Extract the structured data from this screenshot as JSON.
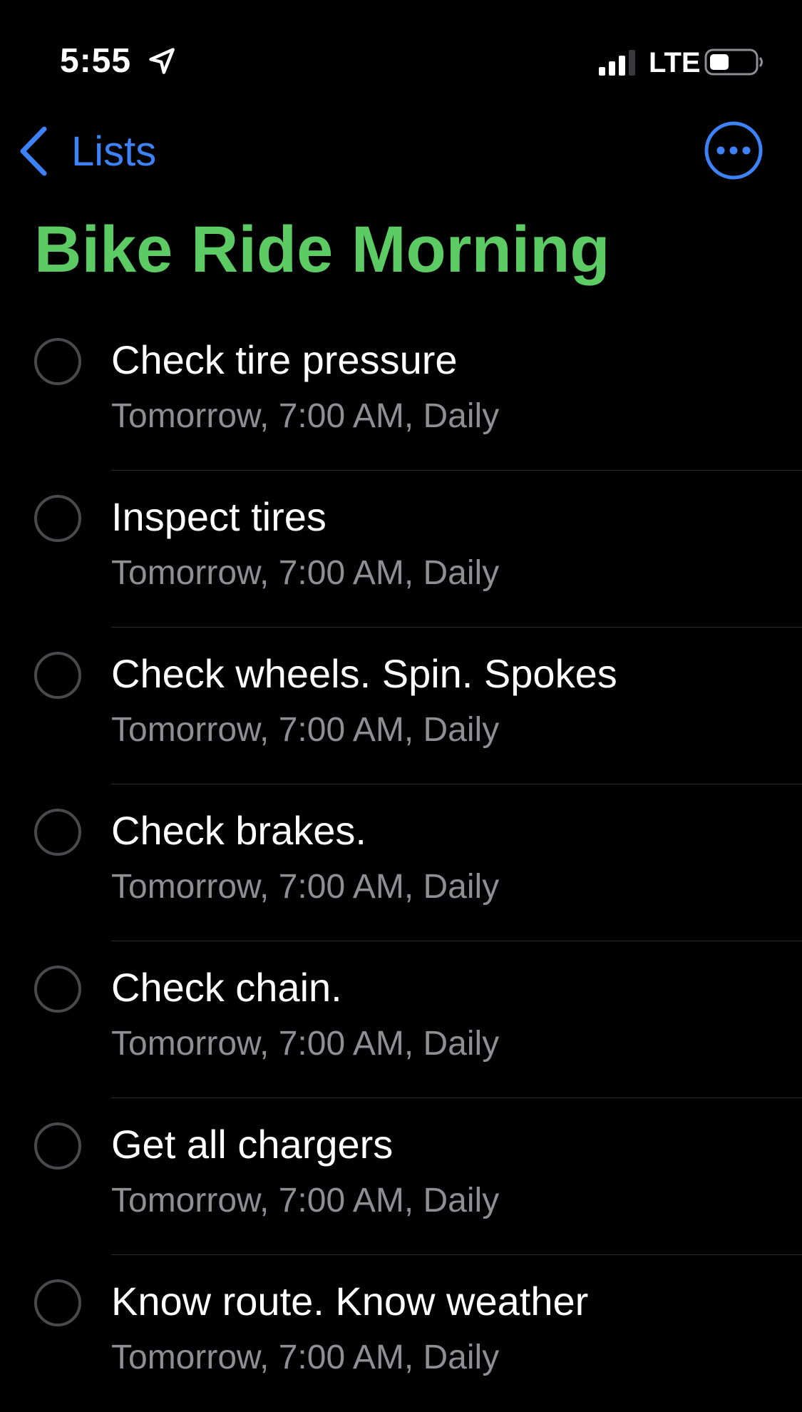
{
  "status_bar": {
    "time": "5:55",
    "location_icon": "location-arrow-icon",
    "signal_icon": "cellular-signal-icon",
    "network": "LTE",
    "battery_icon": "battery-icon"
  },
  "nav": {
    "back_label": "Lists",
    "back_icon": "chevron-left-icon",
    "more_icon": "ellipsis-circle-icon",
    "accent_color": "#3e82f7"
  },
  "list": {
    "title": "Bike Ride Morning",
    "title_color": "#5dcb64",
    "items": [
      {
        "title": "Check tire pressure",
        "detail": "Tomorrow, 7:00 AM, Daily"
      },
      {
        "title": "Inspect tires",
        "detail": "Tomorrow, 7:00 AM, Daily"
      },
      {
        "title": "Check wheels. Spin. Spokes",
        "detail": "Tomorrow, 7:00 AM, Daily"
      },
      {
        "title": "Check brakes.",
        "detail": "Tomorrow, 7:00 AM, Daily"
      },
      {
        "title": "Check chain.",
        "detail": "Tomorrow, 7:00 AM, Daily"
      },
      {
        "title": "Get all chargers",
        "detail": "Tomorrow, 7:00 AM, Daily"
      },
      {
        "title": "Know route. Know weather",
        "detail": "Tomorrow, 7:00 AM, Daily"
      }
    ]
  }
}
